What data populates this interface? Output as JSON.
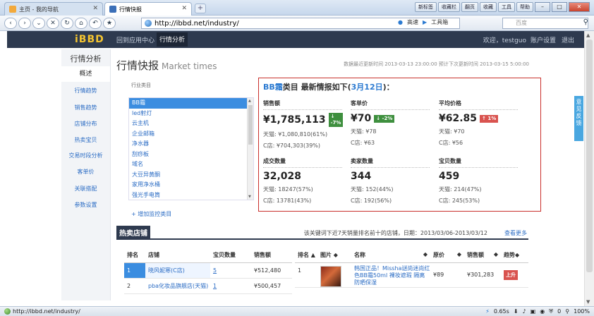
{
  "browser": {
    "tabs": [
      {
        "label": "主页 - 我的导航",
        "active": false
      },
      {
        "label": "行情快报",
        "active": true
      }
    ],
    "top_buttons": [
      "新标签",
      "收藏栏",
      "翻页",
      "收藏",
      "工具",
      "帮助"
    ],
    "address": "http://ibbd.net/industry/",
    "addr_extra": [
      "高速",
      "工具箱"
    ],
    "search_placeholder": "百度",
    "status_url": "http://ibbd.net/industry/",
    "status_items": [
      "0.65s",
      "0",
      "100%"
    ]
  },
  "header": {
    "logo": "iBBD",
    "back": "回到应用中心",
    "current": "行情分析",
    "welcome": "欢迎，testguo",
    "account": "账户设置",
    "logout": "退出"
  },
  "sidebar": {
    "title": "行情分析",
    "selected": "概述",
    "items": [
      "行情趋势",
      "销售趋势",
      "店铺分布",
      "热卖宝贝",
      "交易时段分析",
      "客单价",
      "关联搭配",
      "参数设置"
    ]
  },
  "page": {
    "title": "行情快报",
    "title_en": "Market times",
    "update_info": "数据最近更新时间 2013-03-13 23:00:00    预计下次更新时间 2013-03-15 5:00:00"
  },
  "categories": {
    "label": "行业类目",
    "items": [
      "BB霜",
      "led射灯",
      "云主机",
      "企业邮箱",
      "净水器",
      "刮痧板",
      "域名",
      "大豆异黄酮",
      "家用净水桶",
      "强光手电筒"
    ],
    "selected": "BB霜",
    "add_label": "+ 增加监控类目"
  },
  "summary": {
    "head_cat": "BB霜",
    "head_mid": "类目 最新情报如下(",
    "head_date": "3月12日",
    "head_end": ")：",
    "metrics": [
      {
        "label": "销售额",
        "value": "¥1,785,113",
        "change": "↓ -7%",
        "trend": "down",
        "sub1": "天猫: ¥1,080,810(61%)",
        "sub2": "C店: ¥704,303(39%)"
      },
      {
        "label": "客单价",
        "value": "¥70",
        "change": "↓ -2%",
        "trend": "down",
        "sub1": "天猫: ¥78",
        "sub2": "C店: ¥63"
      },
      {
        "label": "平均价格",
        "value": "¥62.85",
        "change": "↑ 1%",
        "trend": "up",
        "sub1": "天猫: ¥70",
        "sub2": "C店: ¥56"
      },
      {
        "label": "成交数量",
        "value": "32,028",
        "change": "",
        "trend": "",
        "sub1": "天猫: 18247(57%)",
        "sub2": "C店: 13781(43%)"
      },
      {
        "label": "卖家数量",
        "value": "344",
        "change": "",
        "trend": "",
        "sub1": "天猫: 152(44%)",
        "sub2": "C店: 192(56%)"
      },
      {
        "label": "宝贝数量",
        "value": "459",
        "change": "",
        "trend": "",
        "sub1": "天猫: 214(47%)",
        "sub2": "C店: 245(53%)"
      }
    ]
  },
  "hot": {
    "title": "热卖店铺",
    "desc": "该关键词下近7天销量排名前十的店铺，日期：2013/03/06-2013/03/12",
    "more": "查看更多",
    "shop_headers": [
      "排名",
      "店铺",
      "宝贝数量",
      "销售额"
    ],
    "shops": [
      {
        "rank": "1",
        "name": "晓风妮寒(C店)",
        "count": "5",
        "sales": "¥512,480"
      },
      {
        "rank": "2",
        "name": "pba化妆品旗舰店(天猫)",
        "count": "1",
        "sales": "¥500,457"
      }
    ],
    "prod_headers": [
      "排名",
      "图片",
      "名称",
      "原价",
      "销售额",
      "趋势"
    ],
    "products": [
      {
        "rank": "1",
        "name": "韩国正品！Missha谜尚迷尚红色BB霜50ml 裸妆遮瑕 隔离防晒保湿",
        "price": "¥89",
        "sales": "¥301,283",
        "trend": "上升"
      }
    ]
  },
  "feedback": "意见反馈"
}
